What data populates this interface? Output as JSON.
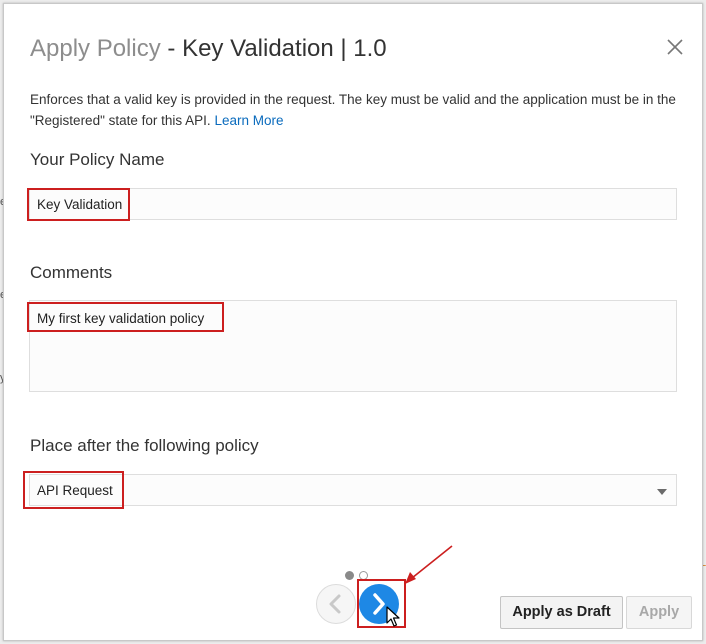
{
  "dialog": {
    "title_prefix": "Apply Policy",
    "title_rest": " - Key Validation | 1.0",
    "description": "Enforces that a valid key is provided in the request. The key must be valid and the application must be in the \"Registered\" state for this API.",
    "learn_more": "Learn More"
  },
  "policy_name": {
    "label": "Your Policy Name",
    "value": "Key Validation"
  },
  "comments": {
    "label": "Comments",
    "value": "My first key validation policy"
  },
  "place_after": {
    "label": "Place after the following policy",
    "selected": "API Request"
  },
  "pagination": {
    "pages": 2,
    "current": 1
  },
  "buttons": {
    "apply_draft": "Apply as Draft",
    "apply": "Apply"
  },
  "icons": {
    "close": "close-icon",
    "prev": "chevron-left-icon",
    "next": "chevron-right-icon",
    "dropdown": "caret-down-icon",
    "cursor": "mouse-pointer-icon"
  },
  "colors": {
    "accent_blue": "#1e88e5",
    "highlight_red": "#cc1f1f",
    "link": "#0a6bbd"
  }
}
